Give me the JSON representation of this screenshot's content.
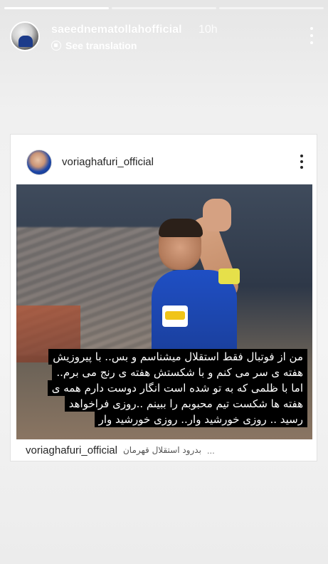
{
  "story": {
    "progress": [
      1.0,
      0.0,
      0.0
    ],
    "username": "saeednematollahofficial",
    "time": "10h",
    "translate_label": "See translation"
  },
  "post": {
    "username": "voriaghafuri_official",
    "caption_overlay": [
      "من از فوتبال فقط استقلال میشناسم و بس.. با پیروزیش",
      "هفته ی سر می کنم و با شکستش هفته ی رنج می برم..",
      "اما با ظلمی که به تو شده است انگار دوست دارم همه ی",
      "هفته ها شکست تیم محبوبم را ببینم ..روزی فراخواهد",
      "رسید .. روزی خورشید وار.. روزی خورشید وار"
    ],
    "caption_user": "voriaghafuri_official",
    "caption_text": "بدرود استقلال قهرمان",
    "caption_ellipsis": "..."
  },
  "colors": {
    "background": "#f0f0f0",
    "caption_bg": "#000000",
    "caption_text": "#ffffff",
    "kit_blue": "#1f4fc4"
  },
  "icons": {
    "translate": "translate-icon",
    "more_story": "more-vertical-icon",
    "more_post": "more-vertical-icon"
  }
}
